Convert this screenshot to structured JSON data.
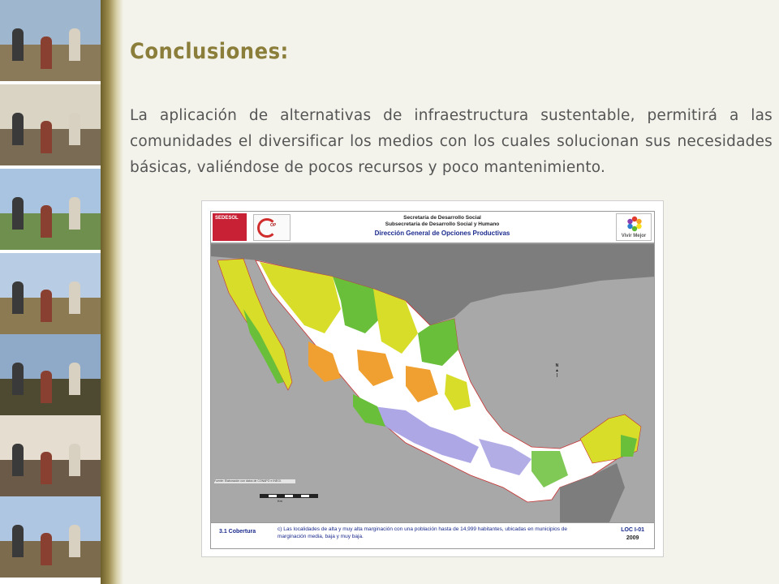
{
  "slide": {
    "title": "Conclusiones:",
    "body": "La aplicación de alternativas de infraestructura sustentable, permitirá a las comunidades el diversificar los medios con los cuales solucionan sus necesidades básicas, valiéndose de pocos recursos y poco mantenimiento."
  },
  "photos": [
    {
      "name": "photo-hillside-construction",
      "sky": "#9fb6cf",
      "ground": "#8b7a5a"
    },
    {
      "name": "photo-group-meeting",
      "sky": "#d9d4c4",
      "ground": "#7a6b55"
    },
    {
      "name": "photo-rural-house",
      "sky": "#a9c4e0",
      "ground": "#6f8f4e"
    },
    {
      "name": "photo-people-field",
      "sky": "#b8cde3",
      "ground": "#8c7a52"
    },
    {
      "name": "photo-sunset-landscape",
      "sky": "#8fa9c8",
      "ground": "#4e4a32"
    },
    {
      "name": "photo-classroom-meeting",
      "sky": "#e4ddd0",
      "ground": "#6b5a48"
    },
    {
      "name": "photo-village-hill",
      "sky": "#aec6e2",
      "ground": "#7d6b4d"
    }
  ],
  "map": {
    "header_line1": "Secretaría de Desarrollo Social",
    "header_line2": "Subsecretaría de Desarrollo Social y Humano",
    "header_line3": "Dirección General de Opciones Productivas",
    "logo_left": "SEDESOL",
    "logo_right": "Vivir Mejor",
    "section_label": "3.1 Cobertura",
    "note": "c) Las localidades de alta y muy alta marginación con una población hasta de 14,999 habitantes, ubicadas en municipios de marginación media, baja y muy baja.",
    "code": "LOC I-01",
    "year": "2009",
    "colors": {
      "sea": "#a8a8a8",
      "us": "#7d7d7d",
      "land": "#ffffff",
      "green": "#6abf3a",
      "yellow": "#d8dd2a",
      "orange": "#f0a030",
      "purple": "#a098e0",
      "red_border": "#c83030"
    }
  }
}
